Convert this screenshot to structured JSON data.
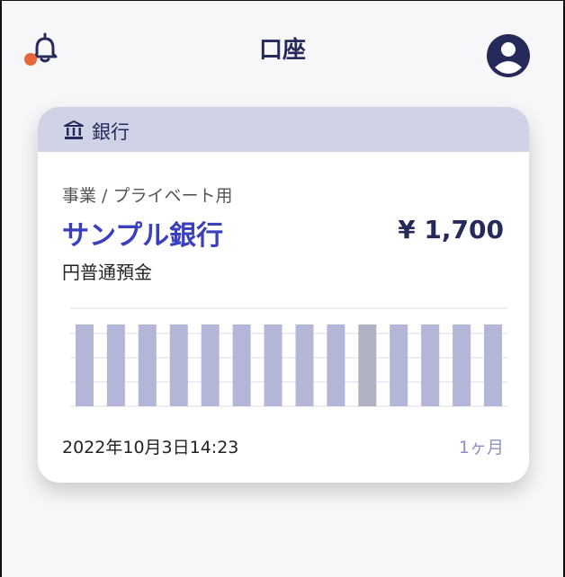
{
  "header": {
    "title": "口座",
    "notification_dot_color": "#e8683c",
    "bell_icon": "bell-icon",
    "avatar_icon": "user-avatar-icon"
  },
  "card": {
    "header_label": "銀行",
    "header_icon": "bank-icon",
    "category": "事業 / プライベート用",
    "bank_name": "サンプル銀行",
    "balance": "¥ 1,700",
    "account_type": "円普通預金",
    "updated_at": "2022年10月3日14:23",
    "period_label": "1ヶ月",
    "accent_color": "#3a3fbd",
    "bar_color": "#b3b6d6",
    "highlight_bar_color": "#b0b2c3"
  },
  "chart_data": {
    "type": "bar",
    "bar_count": 14,
    "highlighted_index": 9
  }
}
